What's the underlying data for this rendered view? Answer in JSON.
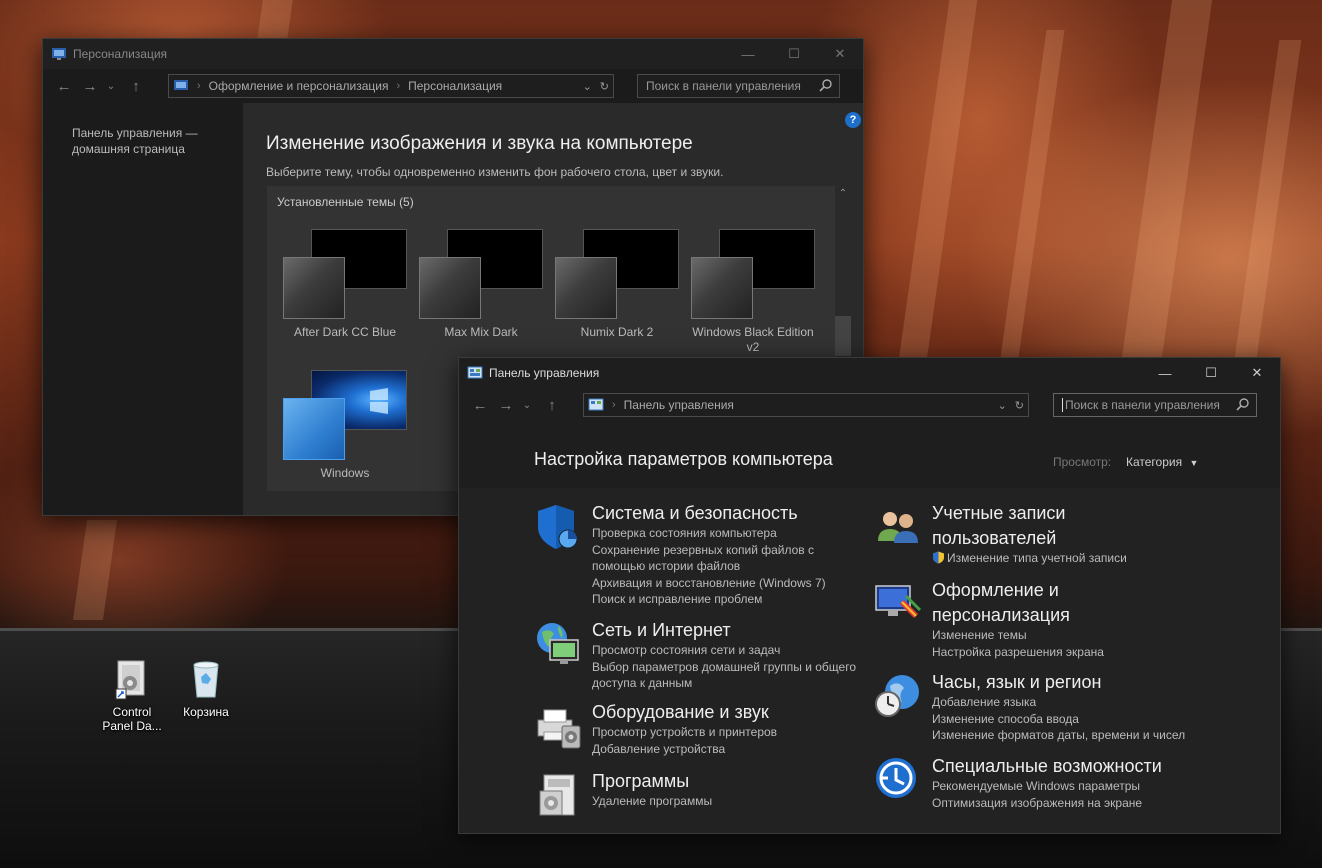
{
  "desktop": {
    "icons": [
      {
        "label": "Control\nPanel Da..."
      },
      {
        "label": "Корзина"
      }
    ]
  },
  "personalization_window": {
    "title": "Персонализация",
    "breadcrumb": [
      "Оформление и персонализация",
      "Персонализация"
    ],
    "search_placeholder": "Поиск в панели управления",
    "sidebar_link": "Панель управления — домашняя страница",
    "heading": "Изменение изображения и звука на компьютере",
    "subheading": "Выберите тему, чтобы одновременно изменить фон рабочего стола, цвет и звуки.",
    "installed_themes_label": "Установленные темы (5)",
    "themes": [
      {
        "name": "After Dark CC Blue"
      },
      {
        "name": "Max Mix Dark"
      },
      {
        "name": "Numix Dark 2"
      },
      {
        "name": "Windows Black Edition v2"
      },
      {
        "name": "Windows"
      }
    ]
  },
  "control_panel_window": {
    "title": "Панель управления",
    "breadcrumb": [
      "Панель управления"
    ],
    "search_placeholder": "Поиск в панели управления",
    "heading": "Настройка параметров компьютера",
    "view_label": "Просмотр:",
    "view_value": "Категория",
    "categories_left": [
      {
        "icon": "shield-icon",
        "title": "Система и безопасность",
        "links": [
          "Проверка состояния компьютера",
          "Сохранение резервных копий файлов с помощью истории файлов",
          "Архивация и восстановление (Windows 7)",
          "Поиск и исправление проблем"
        ]
      },
      {
        "icon": "network-globe-icon",
        "title": "Сеть и Интернет",
        "links": [
          "Просмотр состояния сети и задач",
          "Выбор параметров домашней группы и общего доступа к данным"
        ]
      },
      {
        "icon": "printer-icon",
        "title": "Оборудование и звук",
        "links": [
          "Просмотр устройств и принтеров",
          "Добавление устройства"
        ]
      },
      {
        "icon": "programs-icon",
        "title": "Программы",
        "links": [
          "Удаление программы"
        ]
      }
    ],
    "categories_right": [
      {
        "icon": "users-icon",
        "title": "Учетные записи пользователей",
        "links": [
          "Изменение типа учетной записи"
        ]
      },
      {
        "icon": "appearance-icon",
        "title": "Оформление и персонализация",
        "links": [
          "Изменение темы",
          "Настройка разрешения экрана"
        ]
      },
      {
        "icon": "clock-globe-icon",
        "title": "Часы, язык и регион",
        "links": [
          "Добавление языка",
          "Изменение способа ввода",
          "Изменение форматов даты, времени и чисел"
        ]
      },
      {
        "icon": "accessibility-icon",
        "title": "Специальные возможности",
        "links": [
          "Рекомендуемые Windows параметры",
          "Оптимизация изображения на экране"
        ]
      }
    ]
  }
}
